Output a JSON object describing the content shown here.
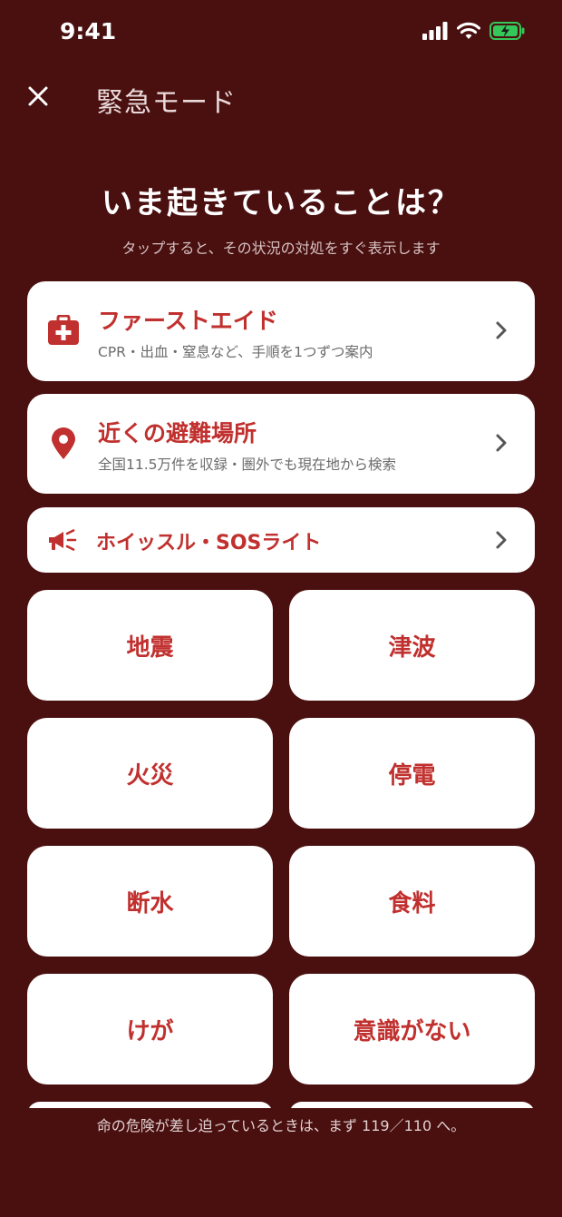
{
  "status_bar": {
    "time": "9:41"
  },
  "top_bar": {
    "title": "緊急モード"
  },
  "heading": "いま起きていることは？",
  "subheading": "タップすると、その状況の対処をすぐ表示します",
  "cards": [
    {
      "title": "ファーストエイド",
      "desc": "CPR・出血・窒息など、手順を1つずつ案内"
    },
    {
      "title": "近くの避難場所",
      "desc": "全国11.5万件を収録・圏外でも現在地から検索"
    },
    {
      "title": "ホイッスル・SOSライト"
    }
  ],
  "tiles": [
    "地震",
    "津波",
    "火災",
    "停電",
    "断水",
    "食料",
    "けが",
    "意識がない"
  ],
  "footer": {
    "text": "命の危険が差し迫っているときは、まず 119／110 へ。"
  },
  "colors": {
    "background": "#4a0f0f",
    "accent": "#c0302e",
    "battery": "#34c759"
  },
  "icons": [
    "close-icon",
    "first-aid-kit-icon",
    "location-pin-icon",
    "megaphone-icon",
    "chevron-right-icon",
    "signal-icon",
    "wifi-icon",
    "battery-charging-icon"
  ]
}
